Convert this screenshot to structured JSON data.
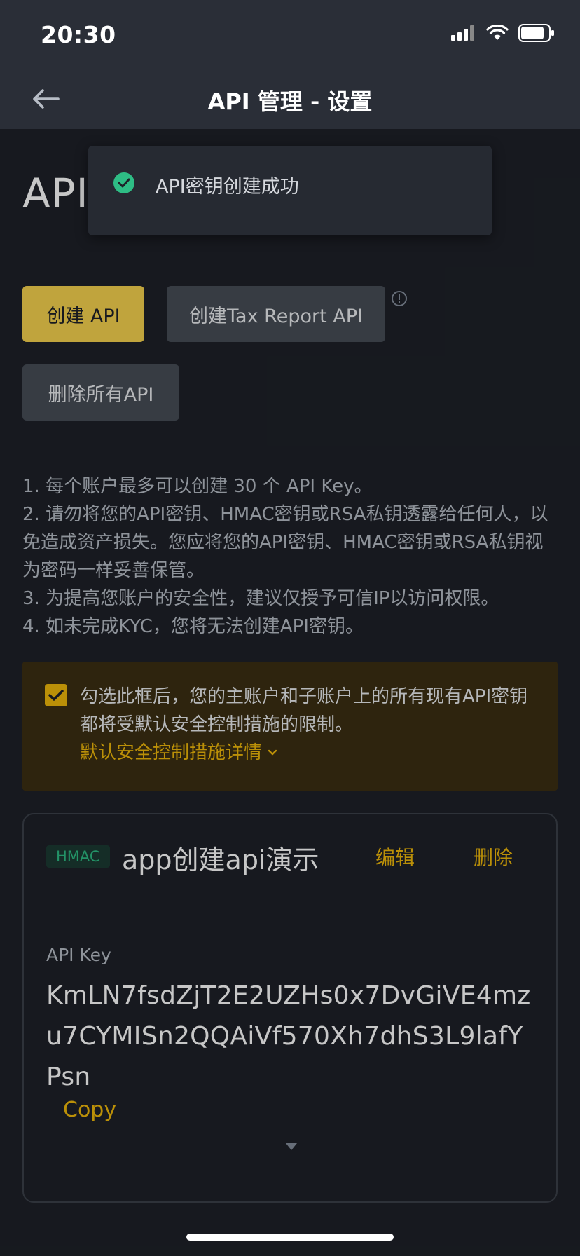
{
  "status_bar": {
    "time": "20:30",
    "icons": [
      "signal-icon",
      "wifi-icon",
      "battery-icon"
    ]
  },
  "nav": {
    "back_icon": "back-arrow-icon",
    "title": "API 管理 - 设置"
  },
  "page": {
    "heading": "API"
  },
  "toast": {
    "icon": "check-circle-icon",
    "message": "API密钥创建成功"
  },
  "buttons": {
    "create_api": "创建 API",
    "create_tax_api": "创建Tax Report API",
    "delete_all": "删除所有API"
  },
  "notes": [
    "1. 每个账户最多可以创建 30 个 API Key。",
    "2. 请勿将您的API密钥、HMAC密钥或RSA私钥透露给任何人，以免造成资产损失。您应将您的API密钥、HMAC密钥或RSA私钥视为密码一样妥善保管。",
    "3. 为提高您账户的安全性，建议仅授予可信IP以访问权限。",
    "4. 如未完成KYC，您将无法创建API密钥。"
  ],
  "warning": {
    "checked": true,
    "text": "勾选此框后，您的主账户和子账户上的所有现有API密钥都将受默认安全控制措施的限制。",
    "link": "默认安全控制措施详情"
  },
  "api_card": {
    "badge": "HMAC",
    "name": "app创建api演示",
    "edit": "编辑",
    "delete": "删除",
    "key_label": "API Key",
    "key_value": "KmLN7fsdZjT2E2UZHs0x7DvGiVE4mzu7CYMISn2QQAiVf570Xh7dhS3L9lafYPsn",
    "copy": "Copy"
  },
  "colors": {
    "accent": "#f0b90b",
    "primary_button": "#f6d24f",
    "background": "#1e2128",
    "success": "#2ebd85"
  }
}
